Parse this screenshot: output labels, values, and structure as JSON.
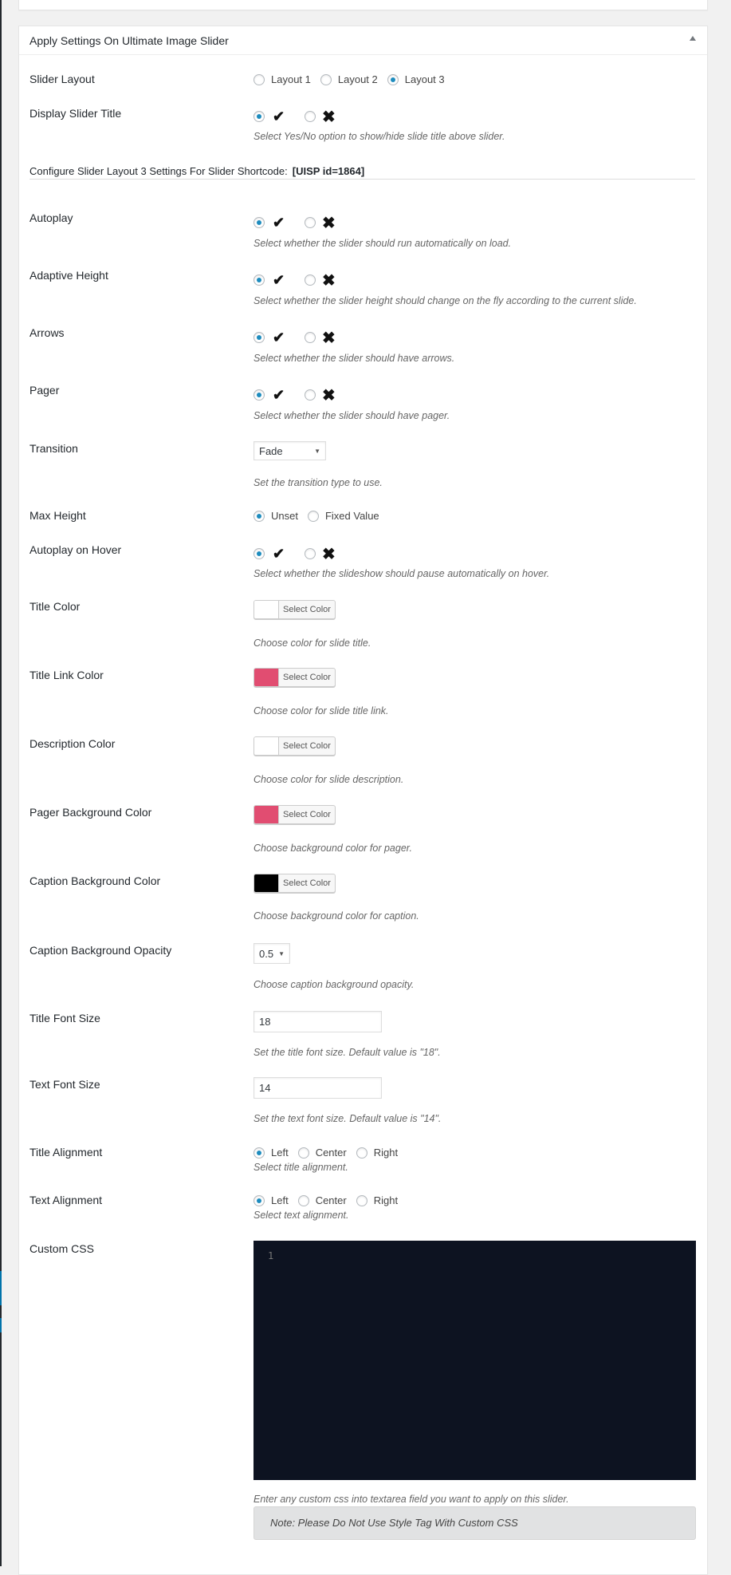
{
  "panel_title": "Apply Settings On Ultimate Image Slider",
  "slider_layout": {
    "label": "Slider Layout",
    "options": [
      "Layout 1",
      "Layout 2",
      "Layout 3"
    ],
    "selected": "Layout 3"
  },
  "display_slider_title": {
    "label": "Display Slider Title",
    "value": "yes",
    "yes_glyph": "✔",
    "no_glyph": "✖",
    "description": "Select Yes/No option to show/hide slide title above slider."
  },
  "shortcode": {
    "text": "Configure Slider Layout 3 Settings For Slider Shortcode:",
    "code": "[UISP id=1864]"
  },
  "autoplay": {
    "label": "Autoplay",
    "value": "yes",
    "description": "Select whether the slider should run automatically on load."
  },
  "adaptive_height": {
    "label": "Adaptive Height",
    "value": "yes",
    "description": "Select whether the slider height should change on the fly according to the current slide."
  },
  "arrows": {
    "label": "Arrows",
    "value": "yes",
    "description": "Select whether the slider should have arrows."
  },
  "pager": {
    "label": "Pager",
    "value": "yes",
    "description": "Select whether the slider should have pager."
  },
  "transition": {
    "label": "Transition",
    "value": "Fade",
    "description": "Set the transition type to use."
  },
  "max_height": {
    "label": "Max Height",
    "options": [
      "Unset",
      "Fixed Value"
    ],
    "selected": "Unset"
  },
  "autoplay_hover": {
    "label": "Autoplay on Hover",
    "value": "yes",
    "description": "Select whether the slideshow should pause automatically on hover."
  },
  "colors": {
    "button_label": "Select Color",
    "title_color": {
      "label": "Title Color",
      "color": "#ffffff",
      "description": "Choose color for slide title."
    },
    "title_link_color": {
      "label": "Title Link Color",
      "color": "#e14d71",
      "description": "Choose color for slide title link."
    },
    "description_color": {
      "label": "Description Color",
      "color": "#ffffff",
      "description": "Choose color for slide description."
    },
    "pager_bg_color": {
      "label": "Pager Background Color",
      "color": "#e14d71",
      "description": "Choose background color for pager."
    },
    "caption_bg_color": {
      "label": "Caption Background Color",
      "color": "#000000",
      "description": "Choose background color for caption."
    }
  },
  "caption_opacity": {
    "label": "Caption Background Opacity",
    "value": "0.5",
    "description": "Choose caption background opacity."
  },
  "title_font_size": {
    "label": "Title Font Size",
    "value": "18",
    "description": "Set the title font size. Default value is \"18\"."
  },
  "text_font_size": {
    "label": "Text Font Size",
    "value": "14",
    "description": "Set the text font size. Default value is \"14\"."
  },
  "title_alignment": {
    "label": "Title Alignment",
    "options": [
      "Left",
      "Center",
      "Right"
    ],
    "selected": "Left",
    "description": "Select title alignment."
  },
  "text_alignment": {
    "label": "Text Alignment",
    "options": [
      "Left",
      "Center",
      "Right"
    ],
    "selected": "Left",
    "description": "Select text alignment."
  },
  "custom_css": {
    "label": "Custom CSS",
    "line_number": "1",
    "value": "",
    "description": "Enter any custom css into textarea field you want to apply on this slider.",
    "note": "Note: Please Do Not Use Style Tag With Custom CSS"
  }
}
